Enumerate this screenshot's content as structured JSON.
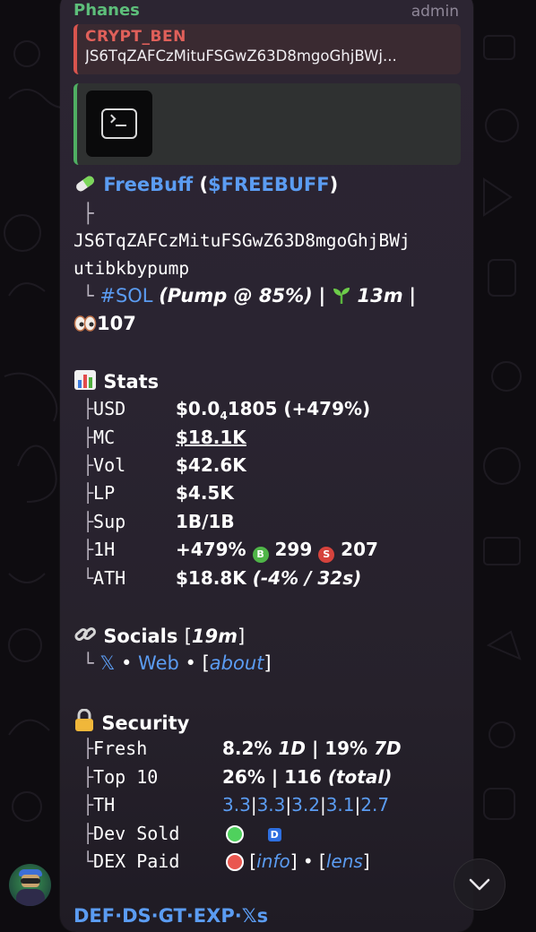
{
  "message": {
    "sender": "Phanes",
    "role": "admin",
    "reply": {
      "name": "CRYPT_BEN",
      "text": "JS6TqZAFCzMituFSGwZ63D8mgoGhjBWj..."
    },
    "media": {
      "icon": "terminal-icon"
    },
    "token": {
      "pill_icon": "pill-icon",
      "name": "FreeBuff",
      "paren_open": "(",
      "ticker": "$FREEBUFF",
      "paren_close": ")",
      "branch1": "├",
      "address_line1": "JS6TqZAFCzMituFSGwZ63D8mgoGhjBWj",
      "address_line2": "utibkbypump",
      "branch2": "└",
      "chain": "#SOL",
      "pump": "(Pump @ 85%)",
      "sep": "|",
      "age_icon": "seedling-icon",
      "age": "13m",
      "sep2": "|",
      "eyes_icon": "eyes-icon",
      "views": "107"
    },
    "stats": {
      "icon": "bar-chart-icon",
      "title": "Stats",
      "rows": [
        {
          "branch": "├",
          "key": "USD",
          "value": "$0.0",
          "sub": "4",
          "value2": "1805",
          "extra": "(+479%)"
        },
        {
          "branch": "├",
          "key": "MC",
          "value": "$18.1K"
        },
        {
          "branch": "├",
          "key": "Vol",
          "value": "$42.6K"
        },
        {
          "branch": "├",
          "key": "LP",
          "value": "$4.5K"
        },
        {
          "branch": "├",
          "key": "Sup",
          "value": "1B/1B"
        },
        {
          "branch": "├",
          "key": "1H",
          "value": "+479%",
          "buy_badge": "B",
          "buys": "299",
          "sell_badge": "S",
          "sells": "207"
        },
        {
          "branch": "└",
          "key": "ATH",
          "value": "$18.8K",
          "extra": "(-4% / 32s)"
        }
      ]
    },
    "socials": {
      "icon": "link-icon",
      "title": "Socials",
      "bracket_open": "[",
      "age": "19m",
      "bracket_close": "]",
      "branch": "└",
      "x": "𝕏",
      "dot1": "•",
      "web": "Web",
      "dot2": "•",
      "about_open": "[",
      "about": "about",
      "about_close": "]"
    },
    "security": {
      "icon": "lock-icon",
      "title": "Security",
      "fresh": {
        "branch": "├",
        "key": "Fresh",
        "v1": "8.2%",
        "v1b": "1D",
        "sep": "|",
        "v2": "19%",
        "v2b": "7D"
      },
      "top10": {
        "branch": "├",
        "key": "Top 10",
        "v1": "26%",
        "sep": "|",
        "v2": "116",
        "v2b": "(total)"
      },
      "th": {
        "branch": "├",
        "key": "TH",
        "values": [
          "3.3",
          "3.3",
          "3.2",
          "3.1",
          "2.7"
        ],
        "sep": "|"
      },
      "dev_sold": {
        "branch": "├",
        "key": "Dev Sold",
        "badge": "D"
      },
      "dex_paid": {
        "branch": "└",
        "key": "DEX Paid",
        "open1": "[",
        "info": "info",
        "close1": "]",
        "dot": "•",
        "open2": "[",
        "lens": "lens",
        "close2": "]"
      }
    },
    "footer_links": "DEF·DS·GT·EXP·𝕏s"
  },
  "colors": {
    "sender": "#5dbe7a",
    "reply_accent": "#d8544e",
    "link": "#5b9cf2",
    "green": "#4fd15d",
    "red": "#e9574f"
  }
}
